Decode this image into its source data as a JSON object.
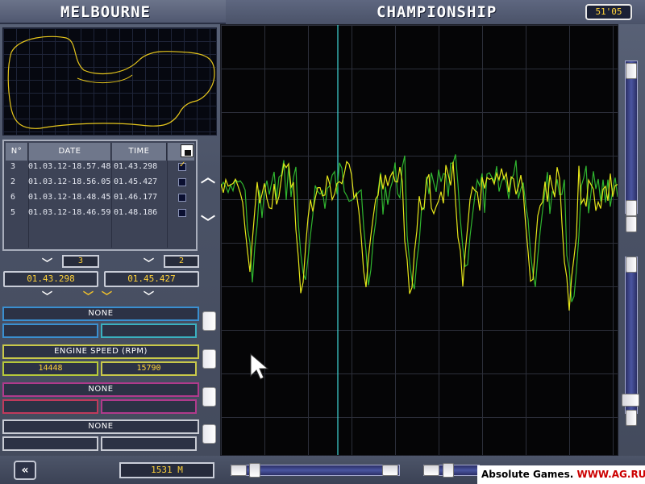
{
  "header": {
    "track_name": "MELBOURNE",
    "mode": "CHAMPIONSHIP",
    "timer": "51'05"
  },
  "lap_table": {
    "columns": [
      "N°",
      "DATE",
      "TIME"
    ],
    "rows": [
      {
        "n": "3",
        "date": "01.03.12-18.57.48",
        "time": "01.43.298",
        "checked": true
      },
      {
        "n": "2",
        "date": "01.03.12-18.56.05",
        "time": "01.45.427",
        "checked": false
      },
      {
        "n": "6",
        "date": "01.03.12-18.48.45",
        "time": "01.46.177",
        "checked": false
      },
      {
        "n": "5",
        "date": "01.03.12-18.46.59",
        "time": "01.48.186",
        "checked": false
      }
    ]
  },
  "compare": {
    "lap_a": "3",
    "lap_b": "2",
    "time_a": "01.43.298",
    "time_b": "01.45.427"
  },
  "channels": [
    {
      "label": "NONE",
      "color": "#3a8fd0",
      "min": "",
      "max": ""
    },
    {
      "label": "ENGINE SPEED (RPM)",
      "color": "#c8c84a",
      "min": "14448",
      "max": "15790"
    },
    {
      "label": "NONE",
      "color": "#b03a8c",
      "min": "",
      "max": ""
    },
    {
      "label": "NONE",
      "color": "#c8cbd4",
      "min": "",
      "max": ""
    }
  ],
  "distance": "1531 M",
  "watermark": {
    "prefix": "Absolute Games. ",
    "suffix": "WWW.AG.RU"
  },
  "colors": {
    "trace_a": "#e6e619",
    "trace_b": "#2fb52f",
    "cursor_line": "#3fd6d6",
    "accent": "#ffd23a"
  },
  "icons": {
    "save": "floppy-disk-icon",
    "back": "double-chevron-left-icon",
    "scroll_up": "chevron-up-icon",
    "scroll_down": "chevron-down-icon"
  }
}
